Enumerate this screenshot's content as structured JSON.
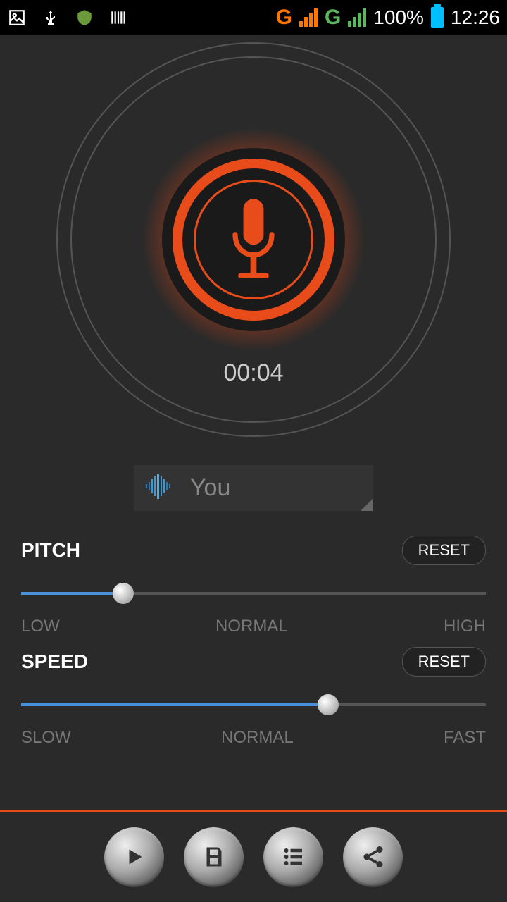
{
  "status": {
    "battery": "100%",
    "time": "12:26"
  },
  "recorder": {
    "timer": "00:04",
    "voice_name": "You"
  },
  "controls": {
    "pitch": {
      "label": "PITCH",
      "reset": "RESET",
      "min_label": "LOW",
      "mid_label": "NORMAL",
      "max_label": "HIGH",
      "value_pct": 22
    },
    "speed": {
      "label": "SPEED",
      "reset": "RESET",
      "min_label": "SLOW",
      "mid_label": "NORMAL",
      "max_label": "FAST",
      "value_pct": 66
    }
  },
  "icons": {
    "play": "play",
    "save": "save",
    "list": "list",
    "share": "share"
  }
}
